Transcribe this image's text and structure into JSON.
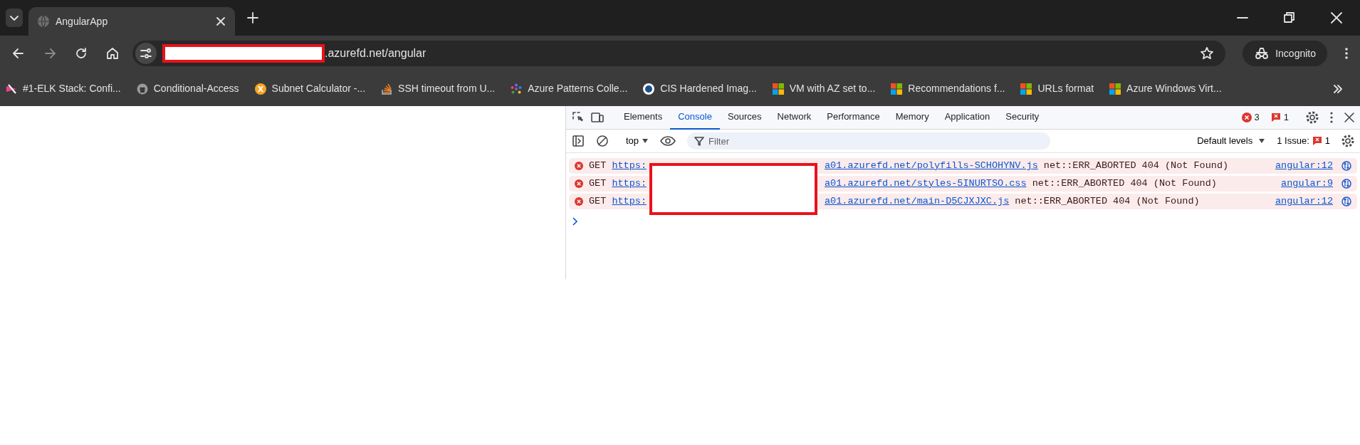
{
  "browser": {
    "tabs": [
      {
        "title": "AngularApp",
        "selected": true
      }
    ],
    "address": {
      "url_redacted": true,
      "url_visible": ".azurefd.net/angular"
    },
    "profile": "Incognito",
    "bookmarks": [
      {
        "label": "#1-ELK Stack: Confi...",
        "kind": "elk"
      },
      {
        "label": "Conditional-Access",
        "kind": "github"
      },
      {
        "label": "Subnet Calculator -...",
        "kind": "xcircle"
      },
      {
        "label": "SSH timeout from U...",
        "kind": "stack"
      },
      {
        "label": "Azure Patterns Colle...",
        "kind": "hub"
      },
      {
        "label": "CIS Hardened Imag...",
        "kind": "cis"
      },
      {
        "label": "VM with AZ set to...",
        "kind": "windows"
      },
      {
        "label": "Recommendations f...",
        "kind": "windows"
      },
      {
        "label": "URLs format",
        "kind": "windows"
      },
      {
        "label": "Azure Windows Virt...",
        "kind": "windows"
      }
    ]
  },
  "devtools": {
    "tabs": [
      {
        "label": "Elements",
        "selected": false
      },
      {
        "label": "Console",
        "selected": true
      },
      {
        "label": "Sources",
        "selected": false
      },
      {
        "label": "Network",
        "selected": false
      },
      {
        "label": "Performance",
        "selected": false
      },
      {
        "label": "Memory",
        "selected": false
      },
      {
        "label": "Application",
        "selected": false
      },
      {
        "label": "Security",
        "selected": false
      }
    ],
    "error_count": "3",
    "issue_count": "1",
    "context": "top",
    "filter_placeholder": "Filter",
    "levels": "Default levels",
    "issues_label": "1 Issue:",
    "issues_count": "1",
    "messages": [
      {
        "kind": "error",
        "method": "GET",
        "link_start": "https:",
        "link_end": "a01.azurefd.net/polyfills-SCHOHYNV.js",
        "detail": "net::ERR_ABORTED 404 (Not Found)",
        "source": "angular:12"
      },
      {
        "kind": "error",
        "method": "GET",
        "link_start": "https:",
        "link_end": "a01.azurefd.net/styles-5INURTSO.css",
        "detail": "net::ERR_ABORTED 404 (Not Found)",
        "source": "angular:9"
      },
      {
        "kind": "error",
        "method": "GET",
        "link_start": "https:",
        "link_end": "a01.azurefd.net/main-D5CJXJXC.js",
        "detail": "net::ERR_ABORTED 404 (Not Found)",
        "source": "angular:12"
      }
    ],
    "redaction_box": true
  }
}
